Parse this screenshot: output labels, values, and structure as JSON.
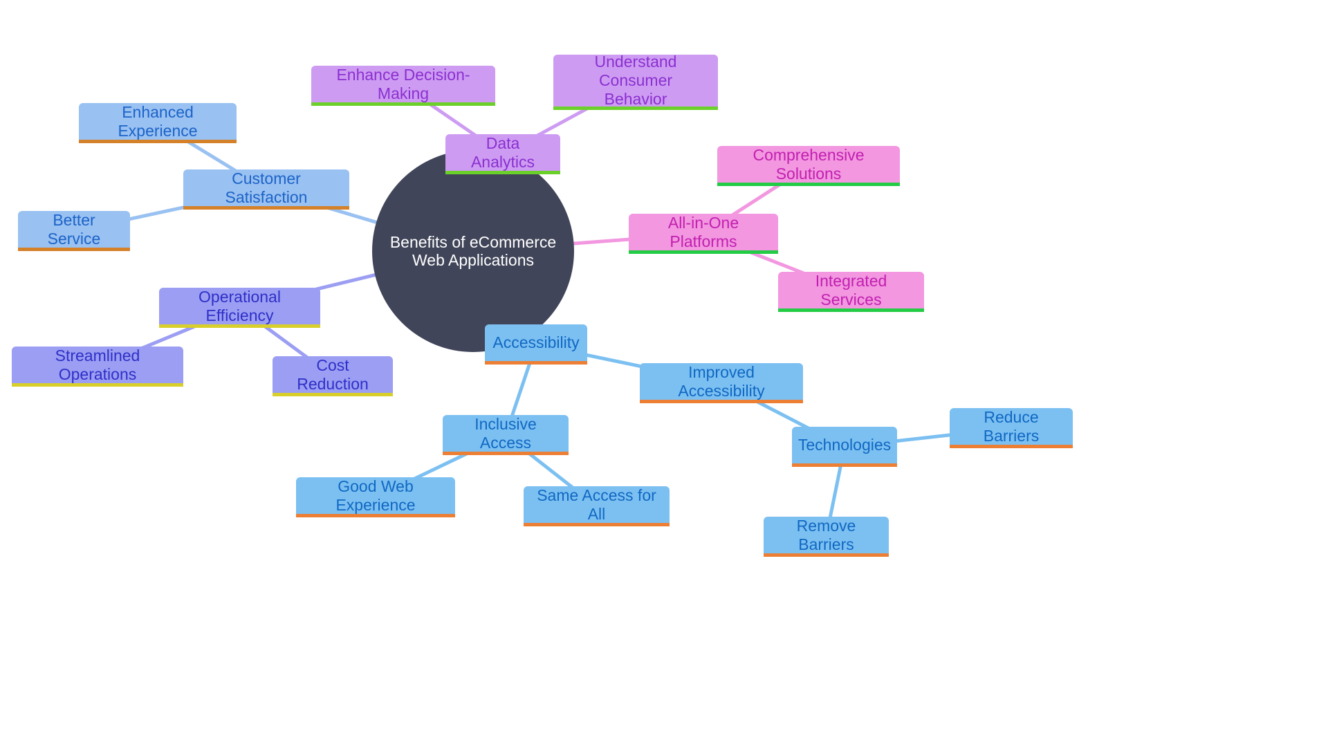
{
  "diagram": {
    "type": "mindmap",
    "root": {
      "label": "Benefits of eCommerce Web Applications",
      "fill": "#414559",
      "text_color": "#ffffff"
    },
    "branches": [
      {
        "id": "customer-satisfaction",
        "label": "Customer Satisfaction",
        "fill": "#99c1f1",
        "text_color": "#1c63c8",
        "underline": "#d4812a",
        "edge_color": "#99c1f1",
        "children": [
          {
            "id": "enhanced-experience",
            "label": "Enhanced Experience"
          },
          {
            "id": "better-service",
            "label": "Better Service"
          }
        ]
      },
      {
        "id": "data-analytics",
        "label": "Data Analytics",
        "fill": "#cd9cf2",
        "text_color": "#8b2fd0",
        "underline": "#6cd02a",
        "edge_color": "#cd9cf2",
        "children": [
          {
            "id": "enhance-decision-making",
            "label": "Enhance Decision-Making"
          },
          {
            "id": "understand-consumer-behavior",
            "label": "Understand Consumer\nBehavior"
          }
        ]
      },
      {
        "id": "all-in-one-platforms",
        "label": "All-in-One Platforms",
        "fill": "#f297e0",
        "text_color": "#c21fb0",
        "underline": "#22cc44",
        "edge_color": "#f297e0",
        "children": [
          {
            "id": "comprehensive-solutions",
            "label": "Comprehensive Solutions"
          },
          {
            "id": "integrated-services",
            "label": "Integrated Services"
          }
        ]
      },
      {
        "id": "operational-efficiency",
        "label": "Operational Efficiency",
        "fill": "#9b9ef2",
        "text_color": "#2f2fc8",
        "underline": "#d8cf2a",
        "edge_color": "#9b9ef2",
        "children": [
          {
            "id": "streamlined-operations",
            "label": "Streamlined Operations"
          },
          {
            "id": "cost-reduction",
            "label": "Cost Reduction"
          }
        ]
      },
      {
        "id": "accessibility",
        "label": "Accessibility",
        "fill": "#7cc0f2",
        "text_color": "#1068c2",
        "underline": "#ec7f34",
        "edge_color": "#7cc0f2",
        "children": [
          {
            "id": "inclusive-access",
            "label": "Inclusive Access",
            "children": [
              {
                "id": "good-web-experience",
                "label": "Good Web Experience"
              },
              {
                "id": "same-access-for-all",
                "label": "Same Access for All"
              }
            ]
          },
          {
            "id": "improved-accessibility",
            "label": "Improved Accessibility",
            "children": [
              {
                "id": "technologies",
                "label": "Technologies",
                "children": [
                  {
                    "id": "reduce-barriers",
                    "label": "Reduce Barriers"
                  },
                  {
                    "id": "remove-barriers",
                    "label": "Remove Barriers"
                  }
                ]
              }
            ]
          }
        ]
      }
    ]
  }
}
